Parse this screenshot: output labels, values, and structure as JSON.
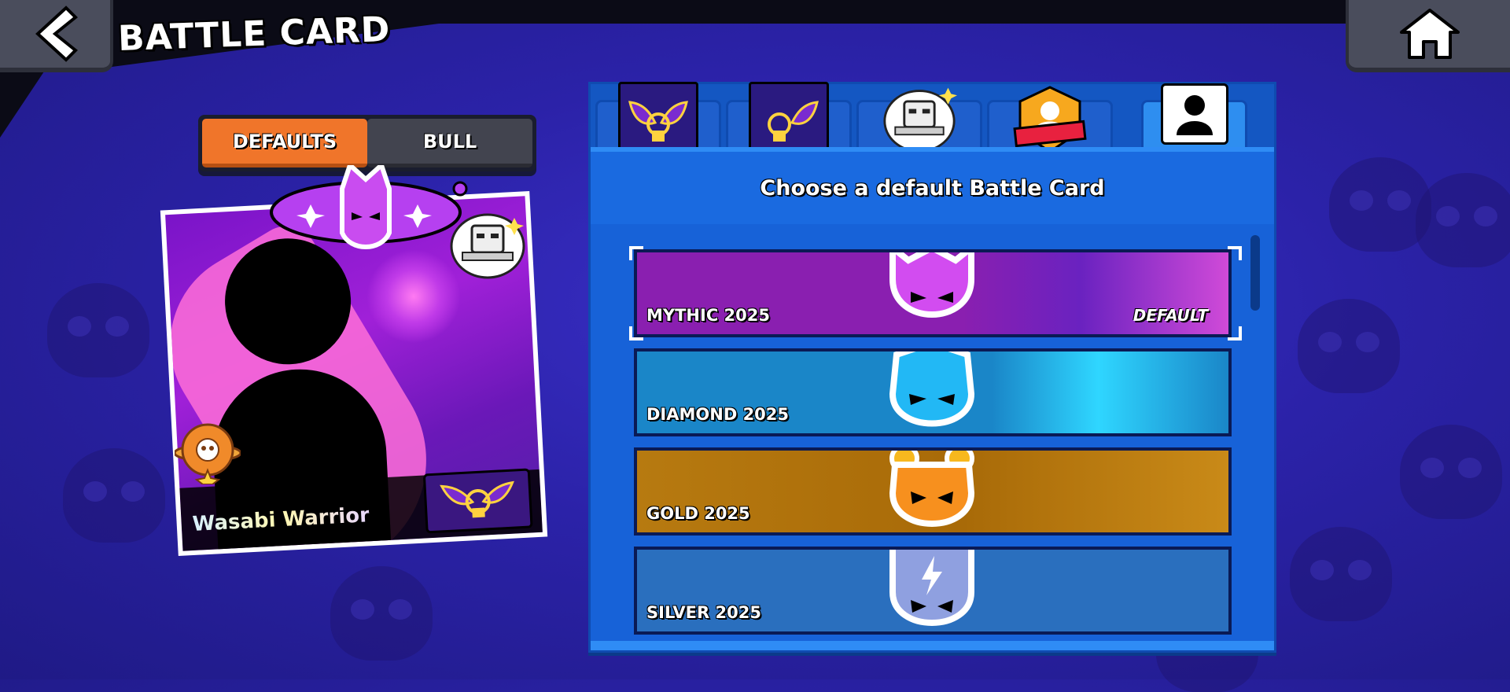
{
  "header": {
    "title": "BATTLE CARD",
    "back_icon": "chevron-left-icon",
    "home_icon": "home-icon"
  },
  "segment": {
    "tabs": [
      {
        "label": "DEFAULTS",
        "active": true
      },
      {
        "label": "BULL",
        "active": false
      }
    ]
  },
  "card": {
    "player_name": "Wasabi Warrior"
  },
  "panel": {
    "title": "Choose a default Battle Card",
    "tabs": [
      {
        "icon": "wings-emblem-icon",
        "active": false
      },
      {
        "icon": "wings-emblem-icon",
        "active": false
      },
      {
        "icon": "robot-pin-icon",
        "active": false
      },
      {
        "icon": "rank-badge-icon",
        "active": false
      },
      {
        "icon": "player-icon",
        "active": true
      }
    ],
    "cards": [
      {
        "label": "MYTHIC 2025",
        "badge": "DEFAULT",
        "selected": true,
        "bg": "#8a1fb0",
        "accent": "#c33ce0",
        "skull": "#d24cf0"
      },
      {
        "label": "DIAMOND 2025",
        "badge": "",
        "selected": false,
        "bg": "#1a86c8",
        "accent": "#2fd6ff",
        "skull": "#22b8f5"
      },
      {
        "label": "GOLD 2025",
        "badge": "",
        "selected": false,
        "bg": "#b77a10",
        "accent": "#e9a52a",
        "skull": "#f7b81e"
      },
      {
        "label": "SILVER 2025",
        "badge": "",
        "selected": false,
        "bg": "#2a6fbe",
        "accent": "#4f8ed8",
        "skull": "#8fa0e0"
      }
    ]
  },
  "colors": {
    "accent_orange": "#f0752a",
    "panel_blue": "#1762d8",
    "background": "#2b22a8"
  }
}
